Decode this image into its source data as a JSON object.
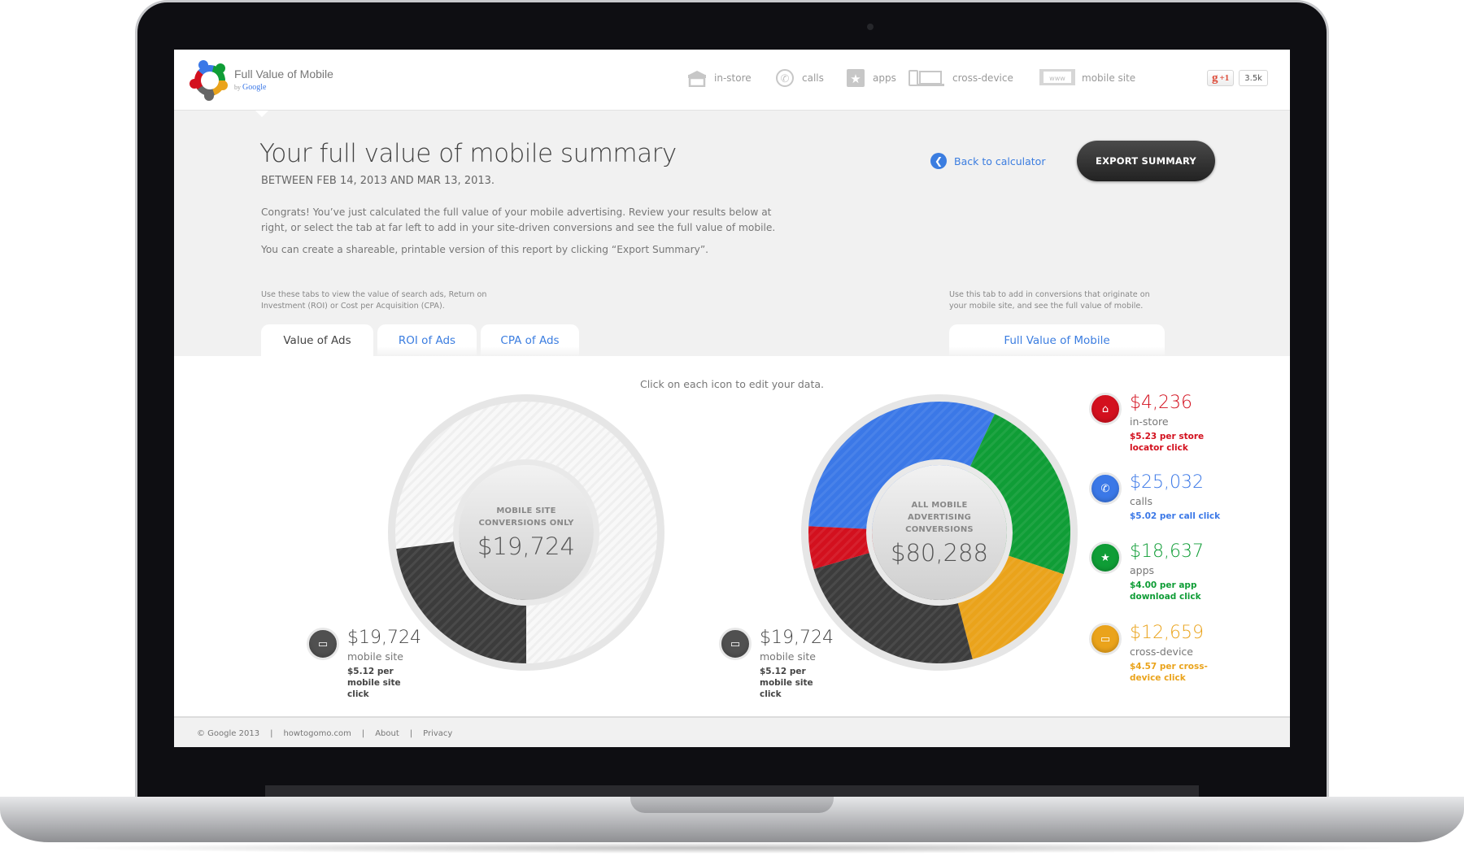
{
  "app": {
    "title": "Full Value of Mobile",
    "by": "by",
    "by_brand": "Google"
  },
  "nav": [
    {
      "label": "in-store",
      "icon": "store-icon"
    },
    {
      "label": "calls",
      "icon": "phone-icon"
    },
    {
      "label": "apps",
      "icon": "star-icon"
    },
    {
      "label": "cross-device",
      "icon": "devices-icon"
    },
    {
      "label": "mobile site",
      "icon": "www-icon"
    }
  ],
  "social": {
    "plus_label": "+1",
    "count": "3.5k"
  },
  "page": {
    "title": "Your full value of mobile summary",
    "date_range": "BETWEEN FEB 14, 2013 AND MAR 13, 2013.",
    "paragraph_1": "Congrats! You’ve just calculated the full value of your mobile advertising. Review your results below at right, or select the tab at far left to add in your site-driven conversions and see the full value of mobile.",
    "paragraph_2": "You can create a shareable, printable version of this report by clicking “Export Summary”.",
    "back_link": "Back to calculator",
    "export_button": "EXPORT SUMMARY"
  },
  "tabs": {
    "left_hint": "Use these tabs to view the value of search ads, Return on Investment (ROI) or Cost per Acquisition (CPA).",
    "right_hint": "Use this tab to add in conversions that originate on your mobile site, and see the full value of mobile.",
    "items": [
      {
        "label": "Value of Ads",
        "active": true
      },
      {
        "label": "ROI of Ads",
        "active": false
      },
      {
        "label": "CPA of Ads",
        "active": false
      }
    ],
    "full_value_tab": "Full Value of Mobile"
  },
  "content": {
    "click_hint": "Click on each icon to edit your data."
  },
  "chart_data": [
    {
      "type": "pie",
      "title": "MOBILE SITE CONVERSIONS ONLY",
      "center_value": "$19,724",
      "categories": [
        "mobile site"
      ],
      "values": [
        19724
      ],
      "highlighted_fraction": 0.23,
      "colors": [
        "#3c3c3c"
      ]
    },
    {
      "type": "pie",
      "title": "ALL MOBILE ADVERTISING CONVERSIONS",
      "center_value": "$80,288",
      "categories": [
        "calls",
        "apps",
        "cross-device",
        "mobile site",
        "in-store"
      ],
      "values": [
        25032,
        18637,
        12659,
        19724,
        4236
      ],
      "colors": [
        "#3b78e7",
        "#0f9d36",
        "#eaa31b",
        "#3c3c3c",
        "#d3101e"
      ]
    }
  ],
  "left_legend": {
    "value": "$19,724",
    "name": "mobile site",
    "rate": "$5.12 per mobile site click"
  },
  "right_mobile_legend": {
    "value": "$19,724",
    "name": "mobile site",
    "rate": "$5.12 per mobile site click"
  },
  "legend": [
    {
      "value": "$4,236",
      "name": "in-store",
      "rate": "$5.23 per store locator click",
      "color": "#d3101e",
      "icon": "store-icon"
    },
    {
      "value": "$25,032",
      "name": "calls",
      "rate": "$5.02 per call click",
      "color": "#3b78e7",
      "icon": "phone-icon"
    },
    {
      "value": "$18,637",
      "name": "apps",
      "rate": "$4.00 per app download click",
      "color": "#0f9d36",
      "icon": "star-icon"
    },
    {
      "value": "$12,659",
      "name": "cross-device",
      "rate": "$4.57 per cross-device click",
      "color": "#eaa31b",
      "icon": "devices-icon"
    }
  ],
  "footer": {
    "copyright": "© Google 2013",
    "sep": "|",
    "site": "howtogomo.com",
    "about": "About",
    "privacy": "Privacy"
  }
}
